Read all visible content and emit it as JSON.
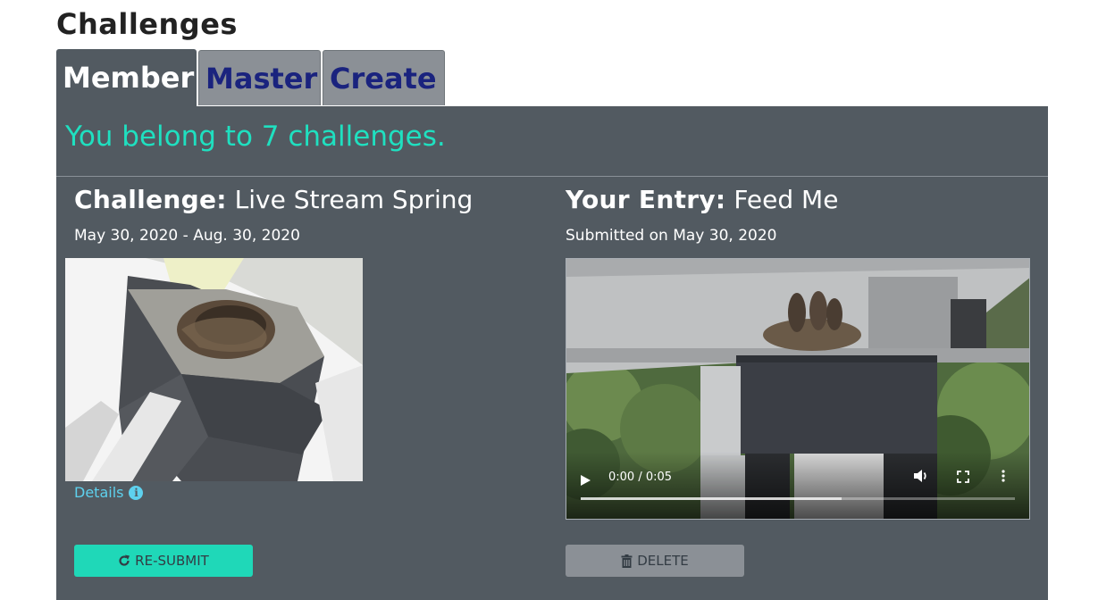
{
  "page": {
    "title": "Challenges"
  },
  "tabs": [
    {
      "label": "Member",
      "active": true
    },
    {
      "label": "Master",
      "active": false
    },
    {
      "label": "Create",
      "active": false
    }
  ],
  "summary": {
    "text": "You belong to 7 challenges."
  },
  "challenge": {
    "heading_label": "Challenge:",
    "name": "Live Stream Spring",
    "date_range": "May 30, 2020 - Aug. 30, 2020",
    "details_label": "Details",
    "resubmit_label": "RE-SUBMIT"
  },
  "entry": {
    "heading_label": "Your Entry:",
    "name": "Feed Me",
    "submitted": "Submitted on May 30, 2020",
    "delete_label": "DELETE",
    "video": {
      "time": "0:00 / 0:05",
      "buffered_fraction": 0.6
    }
  },
  "colors": {
    "accent": "#1fe0c0",
    "panel": "#525a61",
    "tab_inactive_text": "#1a237e",
    "link": "#5ed1ee"
  },
  "icons": {
    "info": "info-icon",
    "redo": "redo-icon",
    "trash": "trash-icon",
    "play": "play-icon",
    "volume": "volume-icon",
    "fullscreen": "fullscreen-icon",
    "more": "more-vertical-icon"
  }
}
